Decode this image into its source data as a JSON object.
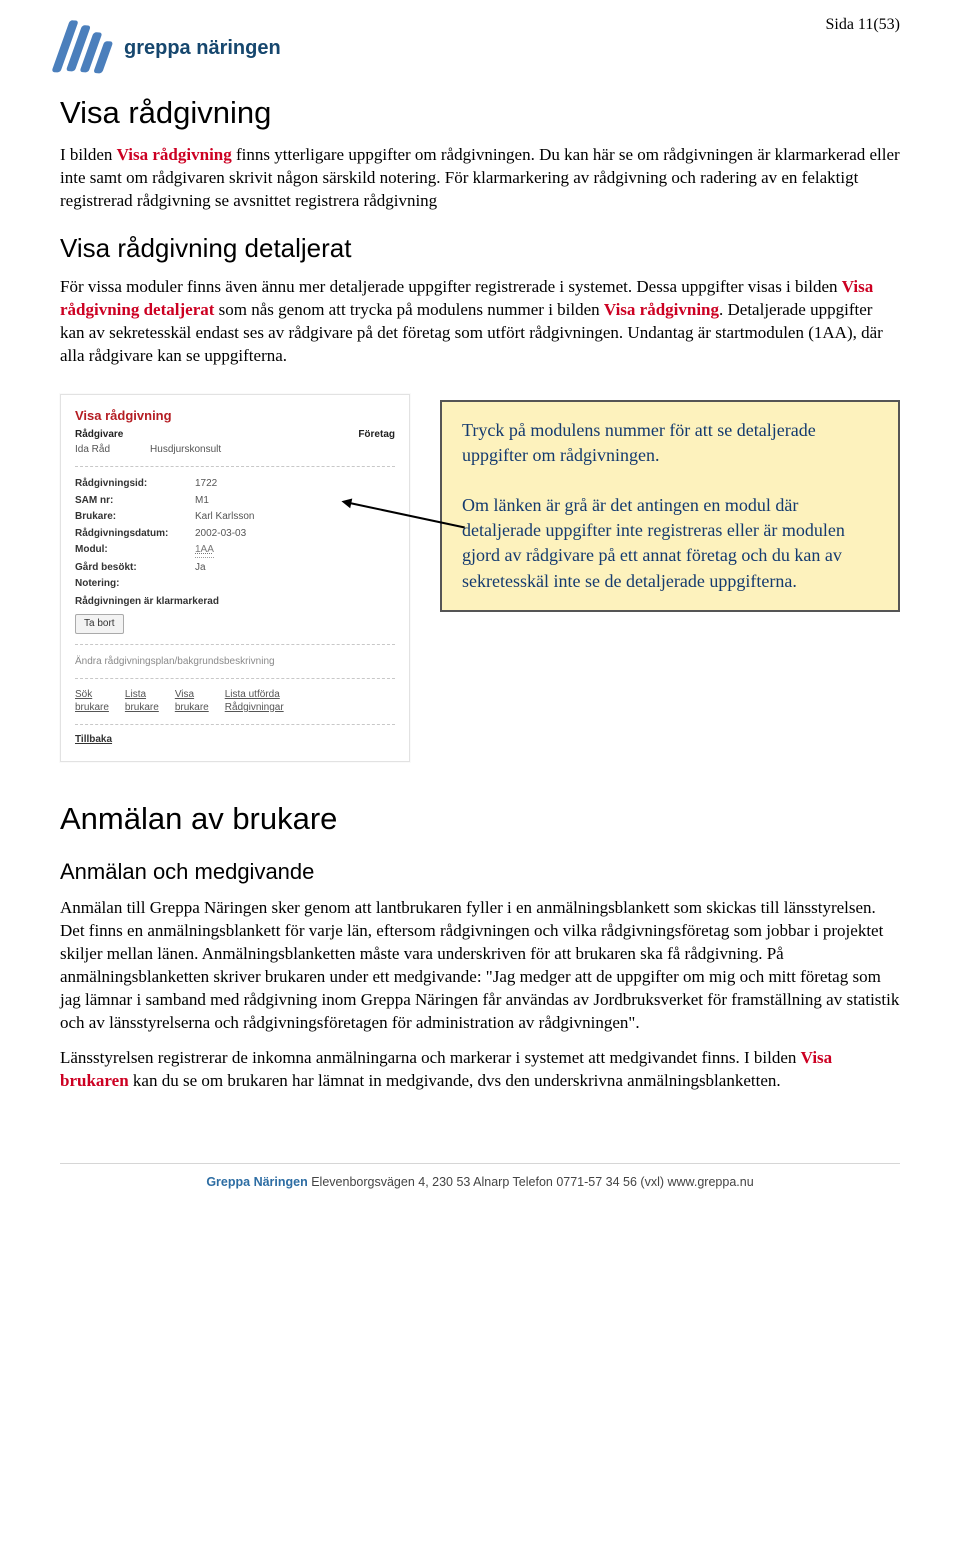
{
  "page_number": "Sida 11(53)",
  "logo_text": "greppa näringen",
  "h1": "Visa rådgivning",
  "p1_pre": "I bilden ",
  "p1_red1": "Visa rådgivning",
  "p1_rest": " finns ytterligare uppgifter om rådgivningen. Du kan här se om rådgivningen är klarmarkerad eller inte samt om rådgivaren skrivit någon särskild notering. För klarmarkering av rådgivning och radering av en felaktigt registrerad rådgivning se avsnittet registrera rådgivning",
  "h2": "Visa rådgivning detaljerat",
  "p2_pre": "För vissa moduler finns även ännu mer detaljerade uppgifter registrerade i systemet. Dessa uppgifter visas i bilden ",
  "p2_red1": "Visa rådgivning detaljerat",
  "p2_mid": " som nås genom att trycka på modulens nummer i bilden ",
  "p2_red2": "Visa rådgivning",
  "p2_end": ". Detaljerade uppgifter kan av sekretesskäl endast ses av rådgivare på det företag som utfört rådgivningen. Undantag är startmodulen (1AA), där alla rådgivare kan se uppgifterna.",
  "panel": {
    "title": "Visa rådgivning",
    "head_left": "Rådgivare",
    "head_right": "Företag",
    "sub_left": "Ida Råd",
    "sub_right": "Husdjurskonsult",
    "rows": {
      "r1k": "Rådgivningsid:",
      "r1v": "1722",
      "r2k": "SAM nr:",
      "r2v": "M1",
      "r3k": "Brukare:",
      "r3v": "Karl Karlsson",
      "r4k": "Rådgivningsdatum:",
      "r4v": "2002-03-03",
      "r5k": "Modul:",
      "r5v": "1AA",
      "r6k": "Gård besökt:",
      "r6v": "Ja",
      "r7k": "Notering:",
      "r8": "Rådgivningen är klarmarkerad"
    },
    "btn": "Ta bort",
    "gray_link": "Ändra rådgivningsplan/bakgrundsbeskrivning",
    "links": {
      "l1a": "Sök",
      "l1b": "brukare",
      "l2a": "Lista",
      "l2b": "brukare",
      "l3a": "Visa",
      "l3b": "brukare",
      "l4a": "Lista utförda",
      "l4b": "Rådgivningar"
    },
    "back": "Tillbaka"
  },
  "callout": {
    "p1": "Tryck på modulens nummer för att se detaljerade uppgifter om rådgivningen.",
    "p2": "Om länken är grå är det antingen en modul där detaljerade uppgifter inte registreras eller är modulen gjord av rådgivare på ett annat företag och du kan av sekretesskäl inte se de detaljerade uppgifterna."
  },
  "h1b": "Anmälan av brukare",
  "h3b": "Anmälan och medgivande",
  "p3": "Anmälan till Greppa Näringen sker genom att lantbrukaren fyller i en anmälningsblankett som skickas till länsstyrelsen. Det finns en anmälningsblankett för varje län, eftersom rådgivningen och vilka rådgivningsföretag som jobbar i projektet skiljer mellan länen. Anmälningsblanketten måste vara underskriven för att brukaren ska få rådgivning. På anmälningsblanketten skriver brukaren under ett medgivande: \"Jag medger att de uppgifter om mig och mitt företag som jag lämnar i samband med rådgivning inom Greppa Näringen får användas av Jordbruksverket för framställning av statistik och av länsstyrelserna och rådgivningsföretagen för administration av rådgivningen\".",
  "p4_pre": "Länsstyrelsen registrerar de inkomna anmälningarna och markerar i systemet att medgivandet finns. I bilden ",
  "p4_red": "Visa brukaren",
  "p4_end": " kan du se om brukaren har lämnat in medgivande, dvs den underskrivna anmälningsblanketten.",
  "footer": {
    "brand": "Greppa Näringen",
    "rest": "  Elevenborgsvägen 4, 230 53 Alnarp   Telefon 0771-57 34 56 (vxl)   www.greppa.nu"
  }
}
